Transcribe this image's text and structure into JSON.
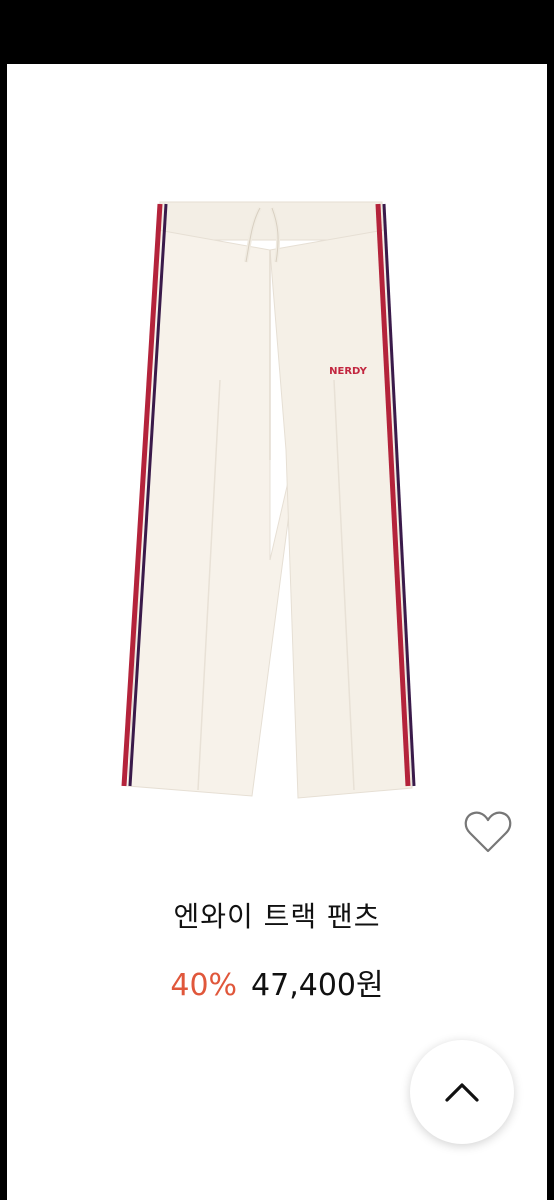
{
  "product": {
    "title": "엔와이 트랙 팬츠",
    "discount": "40%",
    "price": "47,400원",
    "logo_text": "NERDY"
  },
  "icons": {
    "wishlist": "heart-outline-icon",
    "scroll_top": "chevron-up-icon"
  },
  "colors": {
    "discount": "#e0573b",
    "stripe_red": "#b4233b",
    "stripe_navy": "#3a1a4a",
    "pants_fabric": "#f6f1e9"
  }
}
